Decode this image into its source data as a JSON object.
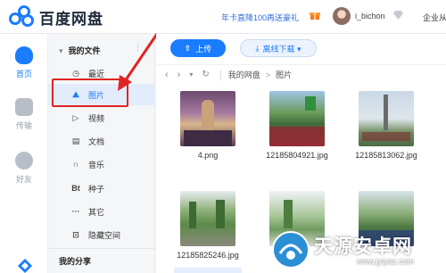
{
  "header": {
    "app_title": "百度网盘",
    "promo": "年卡直降100再送豪礼",
    "username": "i_bichon",
    "company": "企业从"
  },
  "rail": {
    "items": [
      {
        "label": "首页",
        "icon": "cloud-icon",
        "active": true
      },
      {
        "label": "传输",
        "icon": "transfer-icon"
      },
      {
        "label": "好友",
        "icon": "friends-icon"
      }
    ]
  },
  "nav": {
    "my_files": "我的文件",
    "items": [
      {
        "label": "最近",
        "icon": "clock-icon",
        "glyph": "◷"
      },
      {
        "label": "图片",
        "icon": "image-icon",
        "glyph": "⛰"
      },
      {
        "label": "视频",
        "icon": "play-icon",
        "glyph": "▷"
      },
      {
        "label": "文档",
        "icon": "document-icon",
        "glyph": "▤"
      },
      {
        "label": "音乐",
        "icon": "headphones-icon",
        "glyph": "∩"
      },
      {
        "label": "种子",
        "icon": "bt-icon",
        "glyph": "Bt"
      },
      {
        "label": "其它",
        "icon": "more-icon",
        "glyph": "···"
      },
      {
        "label": "隐藏空间",
        "icon": "lock-icon",
        "glyph": "⊡"
      }
    ],
    "my_share": "我的分享"
  },
  "toolbar": {
    "upload": "上传",
    "offline_download": "离线下载 ▾"
  },
  "breadcrumb": {
    "root": "我的网盘",
    "separator": ">",
    "current": "图片"
  },
  "files": [
    {
      "name": "4.png"
    },
    {
      "name": "12185804921.jpg"
    },
    {
      "name": "12185813062.jpg"
    },
    {
      "name": "12185825246.jpg"
    },
    {
      "name": ""
    },
    {
      "name": ""
    }
  ],
  "watermark": {
    "title": "天源安卓网",
    "url": "www.jytyaz.com"
  },
  "colors": {
    "accent": "#1a7cff",
    "highlight": "#e02424"
  }
}
